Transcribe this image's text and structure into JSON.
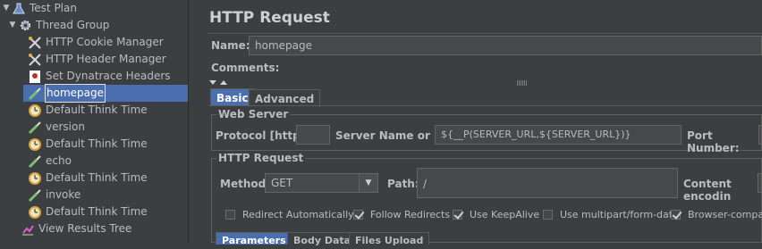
{
  "tree": {
    "items": [
      {
        "label": "Test Plan",
        "icon": "flask-icon",
        "arrow": "▼"
      },
      {
        "label": "Thread Group",
        "icon": "gear-icon",
        "arrow": "▼"
      },
      {
        "label": "HTTP Cookie Manager",
        "icon": "tools-icon"
      },
      {
        "label": "HTTP Header Manager",
        "icon": "tools-icon"
      },
      {
        "label": "Set Dynatrace Headers",
        "icon": "script-icon"
      },
      {
        "label": "homepage",
        "icon": "pipette-icon",
        "selected": true
      },
      {
        "label": "Default Think Time",
        "icon": "timer-icon"
      },
      {
        "label": "version",
        "icon": "pipette-icon"
      },
      {
        "label": "Default Think Time",
        "icon": "timer-icon"
      },
      {
        "label": "echo",
        "icon": "pipette-icon"
      },
      {
        "label": "Default Think Time",
        "icon": "timer-icon"
      },
      {
        "label": "invoke",
        "icon": "pipette-icon"
      },
      {
        "label": "Default Think Time",
        "icon": "timer-icon"
      },
      {
        "label": "View Results Tree",
        "icon": "graph-icon"
      }
    ]
  },
  "panel": {
    "title": "HTTP Request",
    "name_label": "Name:",
    "name_value": "homepage",
    "comments_label": "Comments:",
    "tabs": {
      "basic": "Basic",
      "advanced": "Advanced"
    },
    "web_server": {
      "title": "Web Server",
      "protocol_label": "Protocol [http]:",
      "protocol_value": "",
      "server_label": "Server Name or IP:",
      "server_value": "${__P(SERVER_URL,${SERVER_URL})}",
      "port_label": "Port Number:"
    },
    "http_request": {
      "title": "HTTP Request",
      "method_label": "Method:",
      "method_value": "GET",
      "path_label": "Path:",
      "path_value": "/",
      "encoding_label": "Content encodin"
    },
    "checkboxes": [
      {
        "label": "Redirect Automatically",
        "checked": false
      },
      {
        "label": "Follow Redirects",
        "checked": true
      },
      {
        "label": "Use KeepAlive",
        "checked": true
      },
      {
        "label": "Use multipart/form-data",
        "checked": false
      },
      {
        "label": "Browser-compatib",
        "checked": true
      }
    ],
    "bottom_tabs": [
      "Parameters",
      "Body Data",
      "Files Upload"
    ]
  },
  "colors": {
    "background": "#3c3f41",
    "selection": "#4b6eaf",
    "field": "#45494a"
  }
}
